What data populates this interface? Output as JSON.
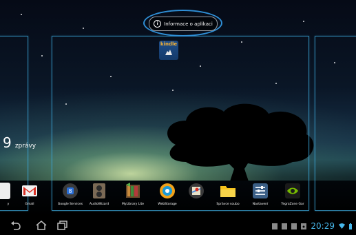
{
  "app_info_button": {
    "label": "Informace o aplikaci",
    "icon": "info-icon"
  },
  "kindle": {
    "label": "kindle"
  },
  "clock_widget": {
    "number": "9",
    "unit": "zprávy"
  },
  "dock": {
    "apps": [
      {
        "label": "Gmail",
        "icon": "gmail-icon"
      },
      {
        "label": "Google Services",
        "icon": "google-services-icon"
      },
      {
        "label": "AudioWizard",
        "icon": "audiowizard-icon"
      },
      {
        "label": "MyLibrary Lite",
        "icon": "mylibrary-icon"
      },
      {
        "label": "WebStorage",
        "icon": "webstorage-icon"
      },
      {
        "label": "",
        "icon": "maps-icon"
      },
      {
        "label": "Správce soubo",
        "icon": "file-manager-icon"
      },
      {
        "label": "Nastavení",
        "icon": "settings-icon"
      },
      {
        "label": "TegraZone Gar",
        "icon": "tegrazone-icon"
      }
    ],
    "partial_label": "y"
  },
  "status_bar": {
    "time": "20:29"
  },
  "colors": {
    "accent": "#2f8fd6",
    "frame": "#3caadc",
    "clock": "#47b7ea"
  }
}
